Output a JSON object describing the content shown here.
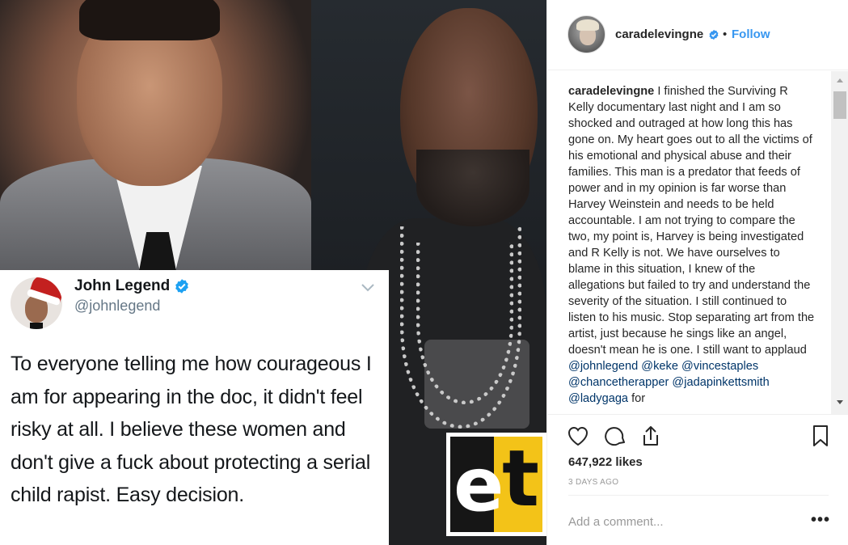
{
  "media": {
    "tweet": {
      "name": "John Legend",
      "handle": "@johnlegend",
      "text": "To everyone telling me how courageous I am for appearing in the doc, it didn't feel risky at all. I believe these women and don't give a fuck about protecting a serial child rapist. Easy decision."
    },
    "watermark": {
      "letters_e": "e",
      "letters_t": "t",
      "caption": "ENTERTAINMENT TONIGHT",
      "accent_color": "#f3c318"
    }
  },
  "post": {
    "username": "caradelevingne",
    "follow_label": "Follow",
    "dot": "•",
    "caption": {
      "username": "caradelevingne",
      "text": " I finished the Surviving R Kelly documentary last night and I am so shocked and outraged at how long this has gone on. My heart goes out to all the victims of his emotional and physical abuse and their families. This man is a predator that feeds of power and in my opinion is far worse than Harvey Weinstein and needs to be held accountable. I am not trying to compare the two, my point is, Harvey is being investigated and R Kelly is not. We have ourselves to blame in this situation, I knew of the allegations but failed to try and understand the severity of the situation. I still continued to listen to his music. Stop separating art from the artist, just because he sings like an angel, doesn't mean he is one. I still want to applaud ",
      "mentions": [
        "@johnlegend",
        "@keke",
        "@vincestaples",
        "@chancetherapper",
        "@jadapinkettsmith",
        "@ladygaga"
      ],
      "tail": " for"
    },
    "likes": "647,922 likes",
    "time": "3 DAYS AGO",
    "comment_placeholder": "Add a comment...",
    "more_label": "•••"
  },
  "colors": {
    "link_blue": "#3897f0",
    "mention_blue": "#003569",
    "verified_blue": "#3897f0",
    "twitter_verified": "#1da1f2"
  }
}
